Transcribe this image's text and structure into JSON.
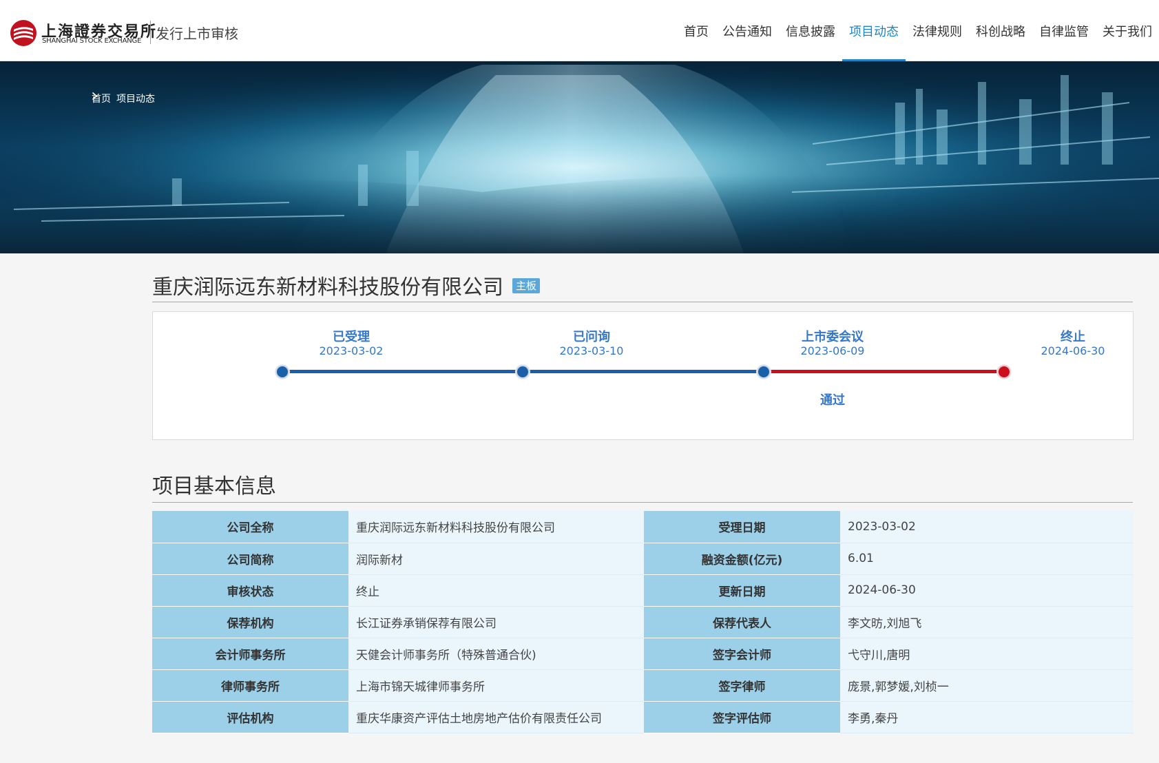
{
  "header": {
    "logo_cn": "上海證券交易所",
    "logo_en": "SHANGHAI STOCK EXCHANGE",
    "site_name": "发行上市审核",
    "nav": [
      {
        "label": "首页",
        "active": false
      },
      {
        "label": "公告通知",
        "active": false
      },
      {
        "label": "信息披露",
        "active": false
      },
      {
        "label": "项目动态",
        "active": true
      },
      {
        "label": "法律规则",
        "active": false
      },
      {
        "label": "科创战略",
        "active": false
      },
      {
        "label": "自律监管",
        "active": false
      },
      {
        "label": "关于我们",
        "active": false
      }
    ],
    "accent_color": "#1d84c8",
    "logo_color": "#c1121f"
  },
  "breadcrumb": {
    "home": "首页",
    "separator_icon": "chevron-right-icon",
    "current": "项目动态"
  },
  "company": {
    "name": "重庆润际远东新材料科技股份有限公司",
    "board_tag": "主板"
  },
  "timeline": {
    "steps": [
      {
        "name": "已受理",
        "date": "2023-03-02",
        "result": ""
      },
      {
        "name": "已问询",
        "date": "2023-03-10",
        "result": ""
      },
      {
        "name": "上市委会议",
        "date": "2023-06-09",
        "result": "通过"
      },
      {
        "name": "终止",
        "date": "2024-06-30",
        "result": ""
      }
    ],
    "progress_color": "#1a5fa8",
    "terminated_color": "#cc0f1e"
  },
  "basic_info": {
    "title": "项目基本信息",
    "rows": [
      {
        "label_left": "公司全称",
        "value_left": "重庆润际远东新材料科技股份有限公司",
        "label_right": "受理日期",
        "value_right": "2023-03-02"
      },
      {
        "label_left": "公司简称",
        "value_left": "润际新材",
        "label_right": "融资金额(亿元)",
        "value_right": "6.01"
      },
      {
        "label_left": "审核状态",
        "value_left": "终止",
        "label_right": "更新日期",
        "value_right": "2024-06-30"
      },
      {
        "label_left": "保荐机构",
        "value_left": "长江证券承销保荐有限公司",
        "label_right": "保荐代表人",
        "value_right": "李文昉,刘旭飞"
      },
      {
        "label_left": "会计师事务所",
        "value_left": "天健会计师事务所（特殊普通合伙)",
        "label_right": "签字会计师",
        "value_right": "弋守川,唐明"
      },
      {
        "label_left": "律师事务所",
        "value_left": "上海市锦天城律师事务所",
        "label_right": "签字律师",
        "value_right": "庞景,郭梦媛,刘桢一"
      },
      {
        "label_left": "评估机构",
        "value_left": "重庆华康资产评估土地房地产估价有限责任公司",
        "label_right": "签字评估师",
        "value_right": "李勇,秦丹"
      }
    ]
  }
}
